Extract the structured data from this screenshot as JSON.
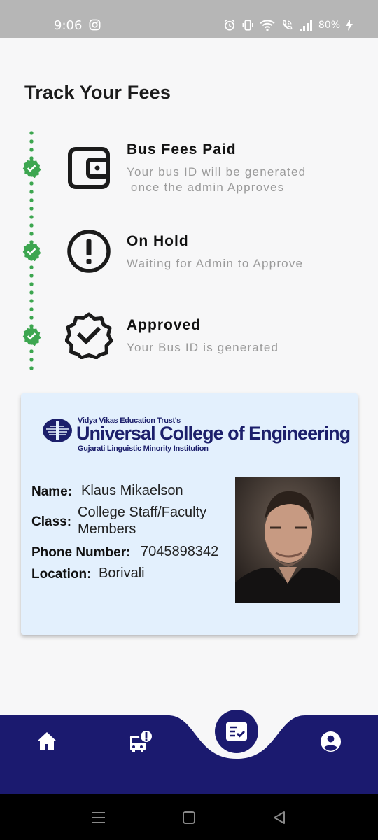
{
  "status_bar": {
    "time": "9:06",
    "battery": "80%"
  },
  "page": {
    "title": "Track Your Fees"
  },
  "steps": [
    {
      "title": "Bus Fees Paid",
      "description": "Your bus ID will be generated\n once the admin Approves",
      "icon": "wallet-icon"
    },
    {
      "title": "On Hold",
      "description": "Waiting for Admin to Approve",
      "icon": "exclamation-circle-icon"
    },
    {
      "title": "Approved",
      "description": "Your Bus ID is generated",
      "icon": "verified-badge-icon"
    }
  ],
  "id_card": {
    "college": {
      "trust": "Vidya Vikas Education Trust's",
      "name": "Universal College of Engineering",
      "subtitle": "Gujarati Linguistic Minority Institution"
    },
    "fields": [
      {
        "label": "Name:",
        "value": "Klaus Mikaelson"
      },
      {
        "label": "Class:",
        "value": "College Staff/Faculty Members"
      },
      {
        "label": "Phone Number:",
        "value": "7045898342"
      },
      {
        "label": "Location:",
        "value": "Borivali"
      }
    ]
  },
  "bottom_nav": {
    "items": [
      "home-icon",
      "bus-alert-icon",
      "fees-tracker-icon",
      "account-icon"
    ],
    "active": "fees-tracker-icon"
  },
  "colors": {
    "accent_navy": "#1b1a6f",
    "success_green": "#3da650",
    "card_bg": "#e3f0fd"
  }
}
